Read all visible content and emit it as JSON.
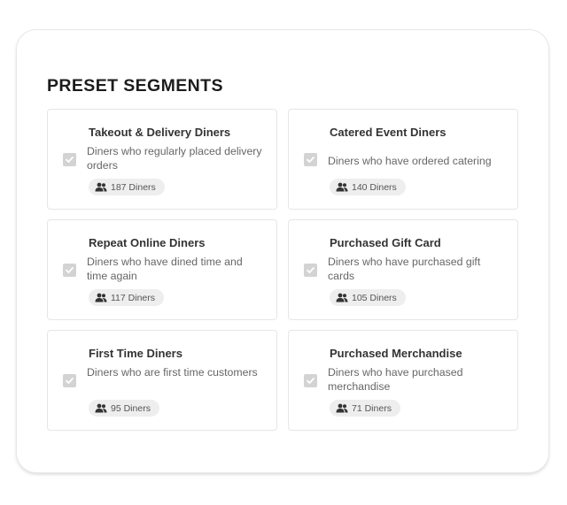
{
  "panel": {
    "title": "PRESET SEGMENTS"
  },
  "segments": [
    {
      "title": "Takeout & Delivery Diners",
      "description": "Diners who regularly placed delivery orders",
      "count": "187 Diners",
      "checked": true
    },
    {
      "title": "Catered Event Diners",
      "description": "Diners who have ordered catering",
      "count": "140 Diners",
      "checked": true
    },
    {
      "title": "Repeat Online Diners",
      "description": "Diners who have dined time and time again",
      "count": "117 Diners",
      "checked": true
    },
    {
      "title": "Purchased Gift Card",
      "description": "Diners who have purchased gift cards",
      "count": "105 Diners",
      "checked": true
    },
    {
      "title": "First Time Diners",
      "description": "Diners who are first time customers",
      "count": "95 Diners",
      "checked": true
    },
    {
      "title": "Purchased Merchandise",
      "description": "Diners who have purchased merchandise",
      "count": "71 Diners",
      "checked": true
    }
  ],
  "icons": {
    "checkbox": "checkmark-icon",
    "badge": "people-icon"
  },
  "colors": {
    "checkbox_fill": "#d3d3d3",
    "badge_background": "#eeeeee",
    "title_text": "#1c1c1c"
  }
}
